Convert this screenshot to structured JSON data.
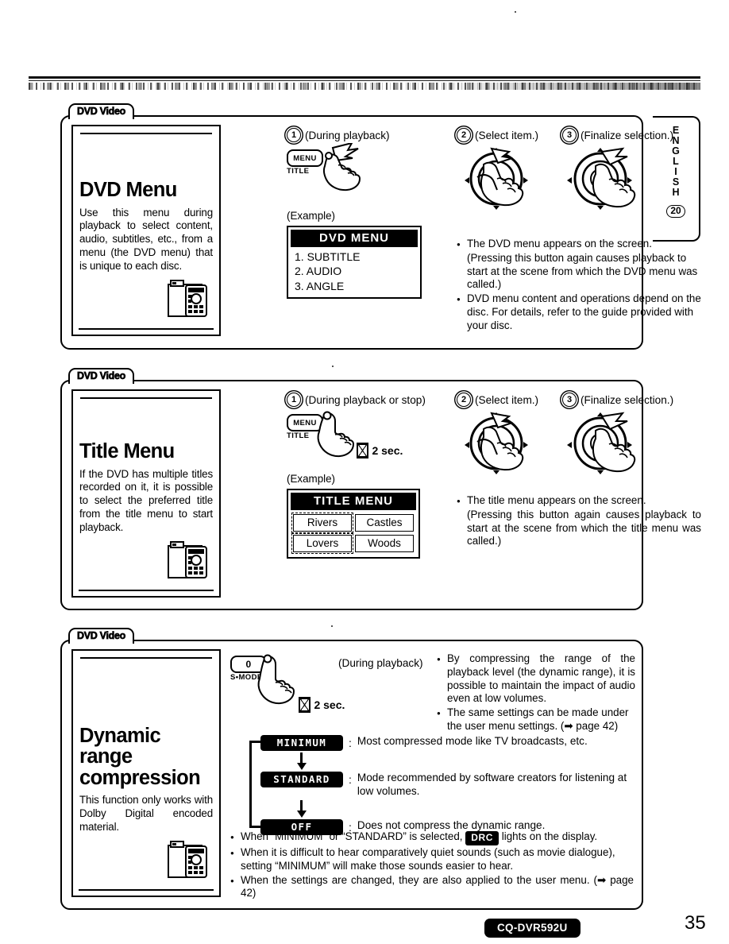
{
  "page": {
    "number": "35",
    "model_badge": "CQ-DVR592U",
    "side_tab": {
      "letters": [
        "E",
        "N",
        "G",
        "L",
        "I",
        "S",
        "H"
      ],
      "number": "20"
    }
  },
  "sections": [
    {
      "tab_label": "DVD Video",
      "panel": {
        "title": "DVD Menu",
        "body": "Use this menu during playback to select content, audio, subtitles, etc., from a menu (the DVD menu) that is unique to each disc.",
        "icon": "remote-control-icon"
      },
      "steps": [
        {
          "num": "1",
          "caption": "(During playback)"
        },
        {
          "num": "2",
          "caption": "(Select item.)"
        },
        {
          "num": "3",
          "caption": "(Finalize selection.)"
        }
      ],
      "button": {
        "label": "MENU",
        "sublabel": "TITLE"
      },
      "example_label": "(Example)",
      "osd": {
        "title": "DVD MENU",
        "items": [
          "1. SUBTITLE",
          "2. AUDIO",
          "3. ANGLE"
        ]
      },
      "notes": [
        "The DVD menu appears on the screen.",
        "(Pressing this button again causes playback to start at the scene from which the DVD menu was called.)",
        "DVD menu content and operations depend on the disc.  For details, refer to the guide provided with your disc."
      ]
    },
    {
      "tab_label": "DVD Video",
      "panel": {
        "title": "Title Menu",
        "body": "If the DVD has multiple titles recorded on it, it is possible to select the preferred title from the title menu to start playback.",
        "icon": "remote-control-icon"
      },
      "steps": [
        {
          "num": "1",
          "caption": "(During playback or stop)"
        },
        {
          "num": "2",
          "caption": "(Select item.)"
        },
        {
          "num": "3",
          "caption": "(Finalize selection.)"
        }
      ],
      "button": {
        "label": "MENU",
        "sublabel": "TITLE"
      },
      "hold_time": "2 sec.",
      "example_label": "(Example)",
      "osd": {
        "title": "TITLE MENU",
        "cells": [
          "Rivers",
          "Castles",
          "Lovers",
          "Woods"
        ]
      },
      "notes": [
        "The title menu appears on the screen.",
        "(Pressing this button again causes playback to start at the scene from which the title menu was called.)"
      ]
    },
    {
      "tab_label": "DVD Video",
      "panel": {
        "title_lines": [
          "Dynamic",
          "range",
          "compression"
        ],
        "body": "This function only works with Dolby Digital encoded material.",
        "icon": "remote-control-icon"
      },
      "button": {
        "label": "0",
        "sublabel": "S•MODE"
      },
      "hold_time": "2 sec.",
      "step_caption": "(During playback)",
      "intro_notes": [
        "By compressing the range of the playback level (the dynamic range), it is possible to maintain the impact of audio even at low volumes.",
        "The same settings can be made under the user menu settings. (➡ page 42)"
      ],
      "modes": [
        {
          "chip": "MINIMUM",
          "desc": "Most compressed mode like TV broadcasts, etc."
        },
        {
          "chip": "STANDARD",
          "desc": "Mode recommended by software creators for listening at low volumes."
        },
        {
          "chip": "OFF",
          "desc": "Does not compress the dynamic range."
        }
      ],
      "notes": [
        {
          "pre": "When “MINIMUM” or “STANDARD” is selected,",
          "chip": "DRC",
          "post": "lights on the display."
        },
        {
          "pre": "When it is difficult to hear comparatively quiet sounds (such as movie dialogue), setting “MINIMUM” will make those sounds easier to hear."
        },
        {
          "pre": "When the settings are changed, they are also applied to the user menu. (➡ page 42)"
        }
      ]
    }
  ]
}
